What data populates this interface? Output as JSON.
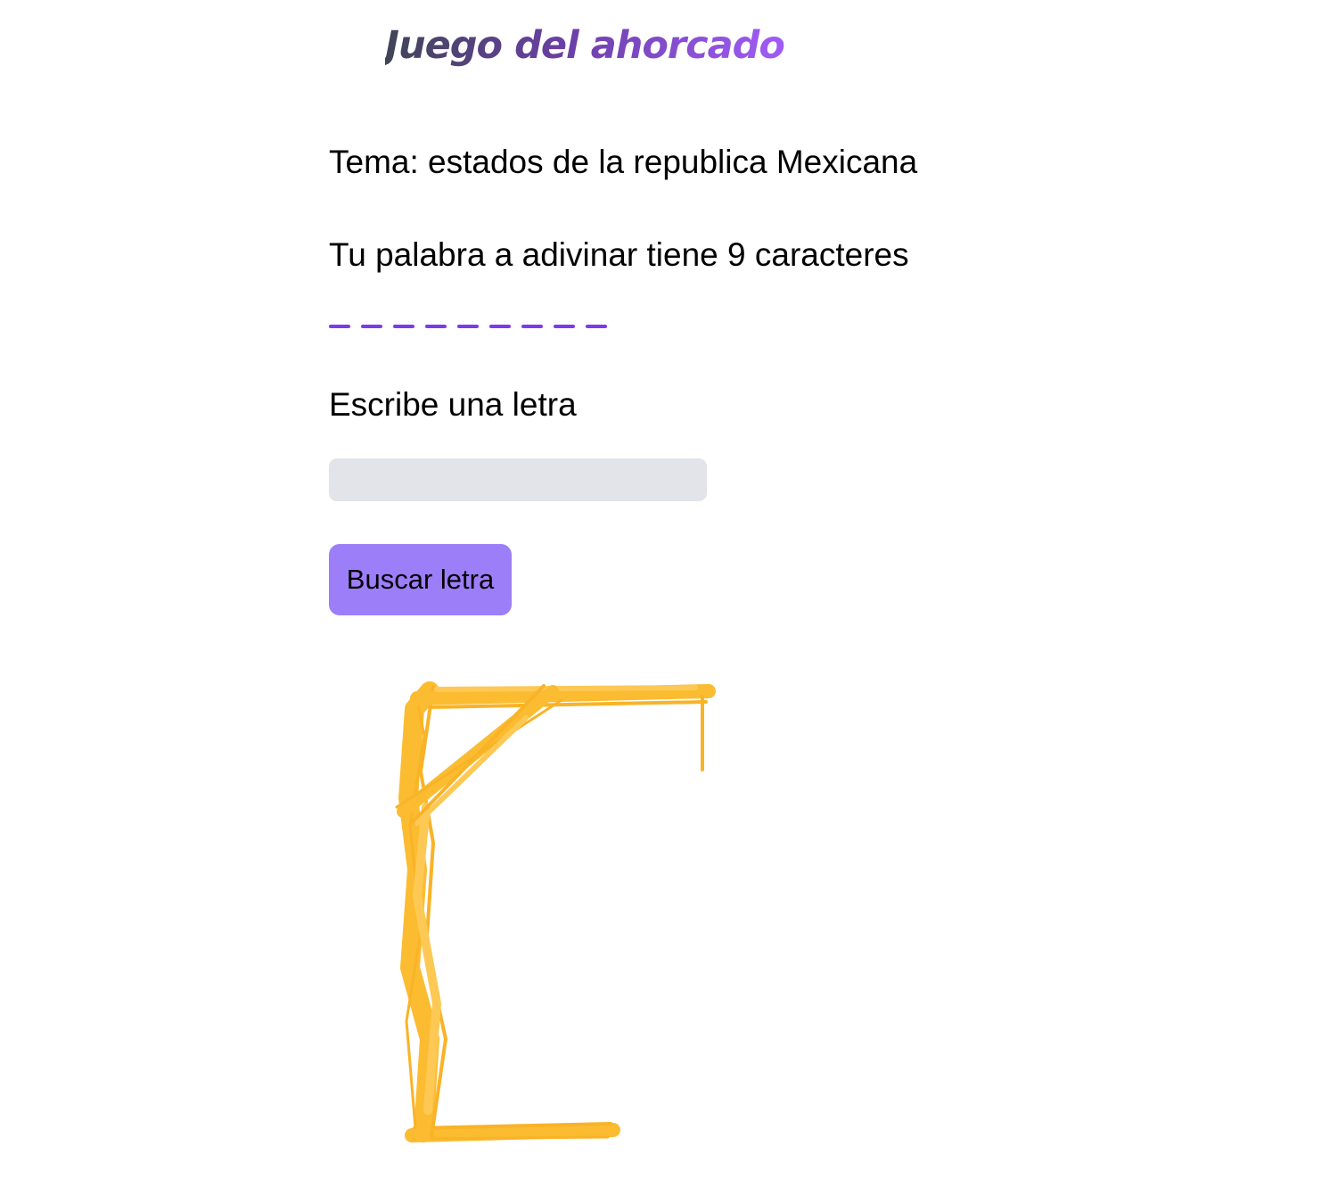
{
  "header": {
    "title": "Juego del ahorcado"
  },
  "game": {
    "topic": "Tema: estados de la republica Mexicana",
    "hint": "Tu palabra a adivinar tiene 9 caracteres",
    "blank_count": 9,
    "prompt": "Escribe una letra",
    "input_value": "",
    "input_placeholder": "",
    "search_button_label": "Buscar letra"
  },
  "colors": {
    "accent": "#7c3aed",
    "button": "#9c7ef9",
    "input_bg": "#e2e4e9",
    "gallows": "#fbb315"
  },
  "hangman": {
    "stage": "gallows-only"
  }
}
